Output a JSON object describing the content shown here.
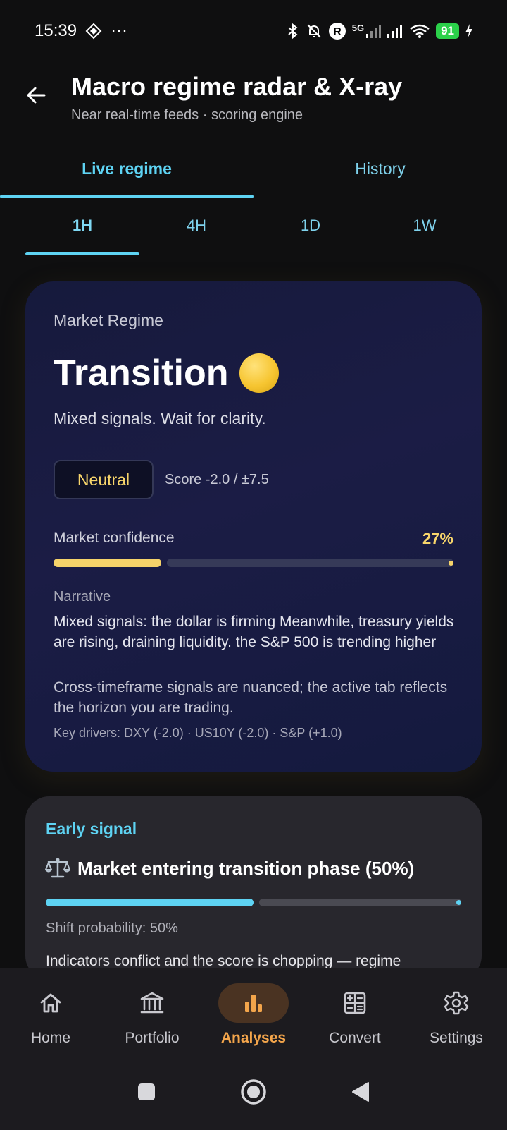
{
  "status_bar": {
    "time": "15:39",
    "more": "···",
    "network": "5G",
    "battery": "91"
  },
  "header": {
    "title": "Macro regime radar & X-ray",
    "subtitle": "Near real-time feeds · scoring engine"
  },
  "main_tabs": [
    {
      "label": "Live regime",
      "active": true
    },
    {
      "label": "History",
      "active": false
    }
  ],
  "timeframes": [
    {
      "label": "1H",
      "active": true
    },
    {
      "label": "4H",
      "active": false
    },
    {
      "label": "1D",
      "active": false
    },
    {
      "label": "1W",
      "active": false
    }
  ],
  "regime_card": {
    "label": "Market Regime",
    "regime": "Transition",
    "description": "Mixed signals. Wait for clarity.",
    "stance": "Neutral",
    "score": "Score -2.0 / ±7.5",
    "confidence_label": "Market confidence",
    "confidence_value": "27%",
    "confidence_fraction": 0.27,
    "narrative_label": "Narrative",
    "narrative": "Mixed signals: the dollar is firming Meanwhile, treasury yields are rising, draining liquidity. the S&P 500 is trending higher",
    "note": "Cross-timeframe signals are nuanced; the active tab reflects the horizon you are trading.",
    "drivers": "Key drivers: DXY (-2.0) · US10Y (-2.0) · S&P (+1.0)",
    "accent": "#f6d36a"
  },
  "early_signal": {
    "label": "Early signal",
    "icon": "balance-scale-icon",
    "title": "Market entering transition phase (50%)",
    "shift_fraction": 0.5,
    "shift_label": "Shift probability: 50%",
    "text": "Indicators conflict and the score is chopping — regime",
    "accent": "#5ed3f3"
  },
  "bottom_nav": [
    {
      "label": "Home",
      "icon": "home-icon",
      "active": false
    },
    {
      "label": "Portfolio",
      "icon": "bank-icon",
      "active": false
    },
    {
      "label": "Analyses",
      "icon": "bar-chart-icon",
      "active": true
    },
    {
      "label": "Convert",
      "icon": "calculator-icon",
      "active": false
    },
    {
      "label": "Settings",
      "icon": "gear-icon",
      "active": false
    }
  ]
}
